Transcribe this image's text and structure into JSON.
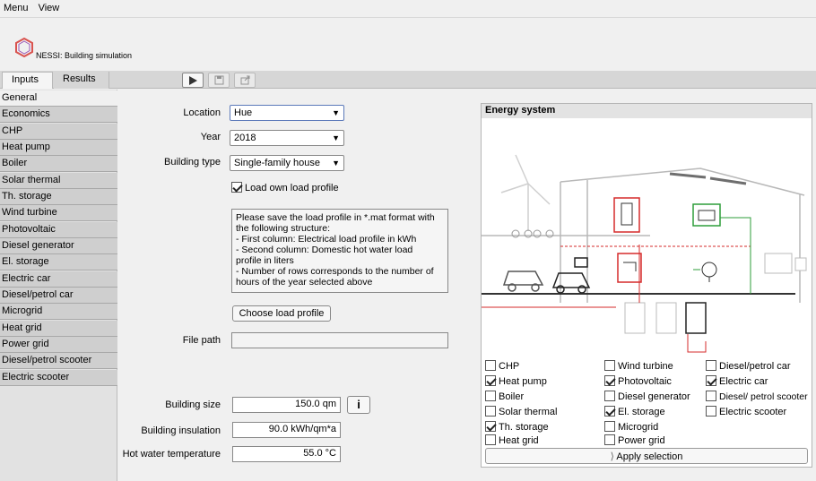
{
  "menu": {
    "items": [
      "Menu",
      "View"
    ]
  },
  "app": {
    "title": "NESSI: Building simulation"
  },
  "tabs": {
    "inputs": "Inputs",
    "results": "Results"
  },
  "toolbar": {
    "run_icon": "play-icon",
    "save_icon": "save-icon",
    "export_icon": "export-icon"
  },
  "sidebar": {
    "items": [
      "General",
      "Economics",
      "CHP",
      "Heat pump",
      "Boiler",
      "Solar thermal",
      "Th. storage",
      "Wind turbine",
      "Photovoltaic",
      "Diesel generator",
      "El. storage",
      "Electric car",
      "Diesel/petrol car",
      "Microgrid",
      "Heat grid",
      "Power grid",
      "Diesel/petrol scooter",
      "Electric scooter"
    ],
    "active": "General"
  },
  "form": {
    "location_label": "Location",
    "location_value": "Hue",
    "year_label": "Year",
    "year_value": "2018",
    "building_type_label": "Building type",
    "building_type_value": "Single-family house",
    "load_profile_checkbox": "Load own load profile",
    "info_text": "Please save the load profile in *.mat format with\nthe following structure:\n- First column: Electrical load profile in kWh\n- Second column: Domestic hot water load\nprofile in liters\n- Number of rows corresponds to the number of\nhours of the year selected above",
    "choose_button": "Choose load profile",
    "file_path_label": "File path",
    "file_path_value": "",
    "building_size_label": "Building size",
    "building_size_value": "150.0 qm",
    "info_button": "i",
    "insulation_label": "Building insulation",
    "insulation_value": "90.0 kWh/qm*a",
    "hot_water_label": "Hot water temperature",
    "hot_water_value": "55.0 °C"
  },
  "energy_system": {
    "title": "Energy system",
    "checkboxes": [
      {
        "label": "CHP",
        "checked": false
      },
      {
        "label": "Heat pump",
        "checked": true
      },
      {
        "label": "Boiler",
        "checked": false
      },
      {
        "label": "Solar thermal",
        "checked": false
      },
      {
        "label": "Th. storage",
        "checked": true
      },
      {
        "label": "Heat grid",
        "checked": false
      },
      {
        "label": "Wind turbine",
        "checked": false
      },
      {
        "label": "Photovoltaic",
        "checked": true
      },
      {
        "label": "Diesel generator",
        "checked": false
      },
      {
        "label": "El. storage",
        "checked": true
      },
      {
        "label": "Microgrid",
        "checked": false
      },
      {
        "label": "Power grid",
        "checked": false
      },
      {
        "label": "Diesel/petrol car",
        "checked": false
      },
      {
        "label": "Electric car",
        "checked": true
      },
      {
        "label": "Diesel/ petrol scooter",
        "checked": false
      },
      {
        "label": "Electric scooter",
        "checked": false
      }
    ],
    "apply_button": "Apply selection"
  },
  "colors": {
    "selected_select_border": "#5b79b9",
    "heat_line": "#d62b2b",
    "power_line": "#2e9d3a"
  }
}
